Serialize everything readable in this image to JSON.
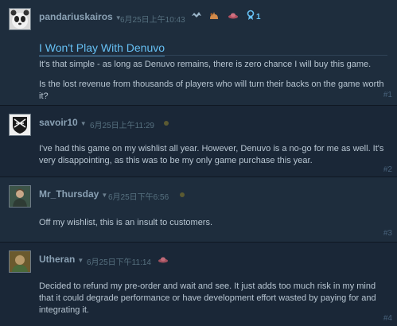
{
  "posts": [
    {
      "author": "pandariuskairos",
      "timestamp": "6月25日上午10:43",
      "award_count": "1",
      "title": "I Won't Play With Denuvo",
      "paragraphs": [
        "It's that simple - as long as Denuvo remains, there is zero chance I will buy this game.",
        "Is the lost revenue from thousands of players who will turn their backs on the game worth it?"
      ],
      "number": "#1"
    },
    {
      "author": "savoir10",
      "timestamp": "6月25日上午11:29",
      "paragraphs": [
        "I've had this game on my wishlist all year. However, Denuvo is a no-go for me as well. It's very disappointing, as this was to be my only game purchase this year."
      ],
      "number": "#2"
    },
    {
      "author": "Mr_Thursday",
      "timestamp": "6月25日下午6:56",
      "paragraphs": [
        "Off my wishlist, this is an insult to customers."
      ],
      "number": "#3"
    },
    {
      "author": "Utheran",
      "timestamp": "6月25日下午11:14",
      "paragraphs": [
        "Decided to refund my pre-order and wait and see. It just adds too much risk in my mind that it could degrade performance or have development effort wasted by paying for and integrating it."
      ],
      "number": "#4"
    }
  ],
  "icons": {
    "caret": "chevron-down-icon",
    "award_badges": [
      "dragon-award-icon",
      "cat-award-icon",
      "ufo-award-icon",
      "medal-award-icon"
    ],
    "status_dot": "status-dot-icon"
  },
  "colors": {
    "background": "#1b2838",
    "link": "#66c0f4",
    "author": "#8aa1b4",
    "text": "#b8c6d2"
  }
}
